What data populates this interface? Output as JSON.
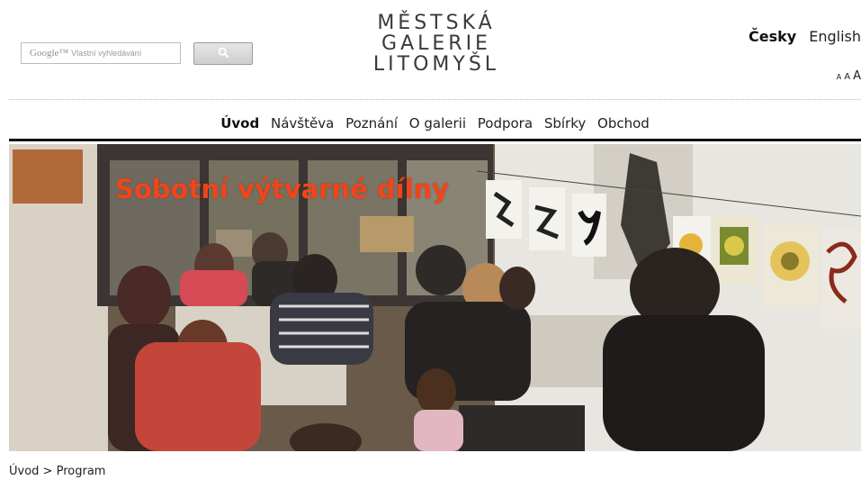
{
  "search": {
    "google_label": "Google™",
    "placeholder": "Vlastní vyhledávání",
    "button_icon": "search-icon"
  },
  "logo": {
    "line1": "MĚSTSKÁ",
    "line2": "GALERIE",
    "line3": "LITOMYŠL"
  },
  "languages": {
    "active": "Česky",
    "other": "English"
  },
  "font_size": {
    "small": "A",
    "medium": "A",
    "large": "A"
  },
  "nav": {
    "items": [
      "Úvod",
      "Návštěva",
      "Poznání",
      "O galerii",
      "Podpora",
      "Sbírky",
      "Obchod"
    ],
    "current": "Úvod"
  },
  "hero": {
    "title": "Sobotní výtvarné dílny",
    "title_color": "#f0451a"
  },
  "breadcrumb": {
    "home": "Úvod",
    "separator": " > ",
    "current": "Program"
  }
}
